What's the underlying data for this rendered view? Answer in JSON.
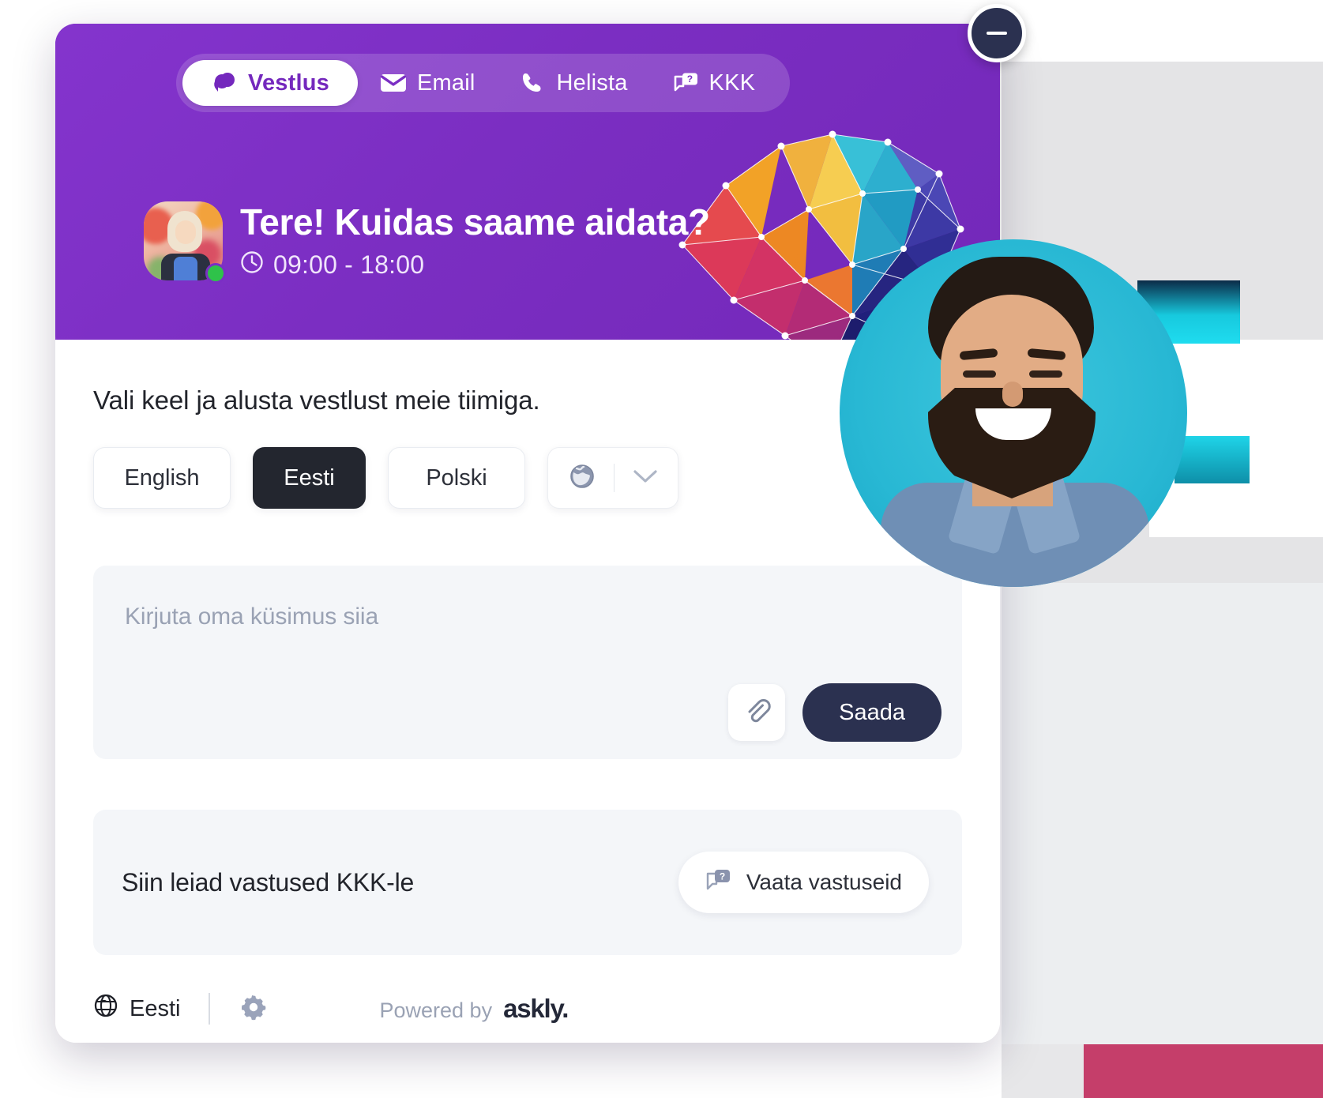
{
  "window": {
    "minimize_label": "Minimize chat"
  },
  "tabs": [
    {
      "label": "Vestlus",
      "icon": "chat-bubble-icon",
      "active": true
    },
    {
      "label": "Email",
      "icon": "envelope-icon",
      "active": false
    },
    {
      "label": "Helista",
      "icon": "phone-icon",
      "active": false
    },
    {
      "label": "KKK",
      "icon": "faq-icon",
      "active": false
    }
  ],
  "header": {
    "greeting": "Tere! Kuidas saame aidata?",
    "hours": "09:00 - 18:00",
    "clock_icon": "clock-icon",
    "avatar_alt": "agent-avatar",
    "online_status": "online",
    "brain_graphic": "ai-brain-icon"
  },
  "main": {
    "prompt": "Vali keel ja alusta vestlust meie tiimiga.",
    "languages": [
      {
        "label": "English",
        "selected": false
      },
      {
        "label": "Eesti",
        "selected": true
      },
      {
        "label": "Polski",
        "selected": false
      }
    ],
    "more_languages": {
      "globe_icon": "globe-icon",
      "chevron_icon": "chevron-down-icon"
    },
    "composer": {
      "placeholder": "Kirjuta oma küsimus siia",
      "value": "",
      "attach_icon": "paperclip-icon",
      "send_label": "Saada"
    },
    "faq": {
      "text": "Siin leiad vastused KKK-le",
      "button_label": "Vaata vastuseid",
      "button_icon": "faq-icon"
    }
  },
  "footer": {
    "language": "Eesti",
    "globe_icon": "globe-icon",
    "settings_icon": "gear-icon",
    "powered_label": "Powered by",
    "brand": "askly",
    "brand_dot": "."
  },
  "colors": {
    "header_purple": "#7b2fc4",
    "accent_dark": "#2b3150",
    "selected_language": "#23262f",
    "panel_grey": "#f4f6f9",
    "online_green": "#2fc24a",
    "teal": "#28b8d4"
  }
}
